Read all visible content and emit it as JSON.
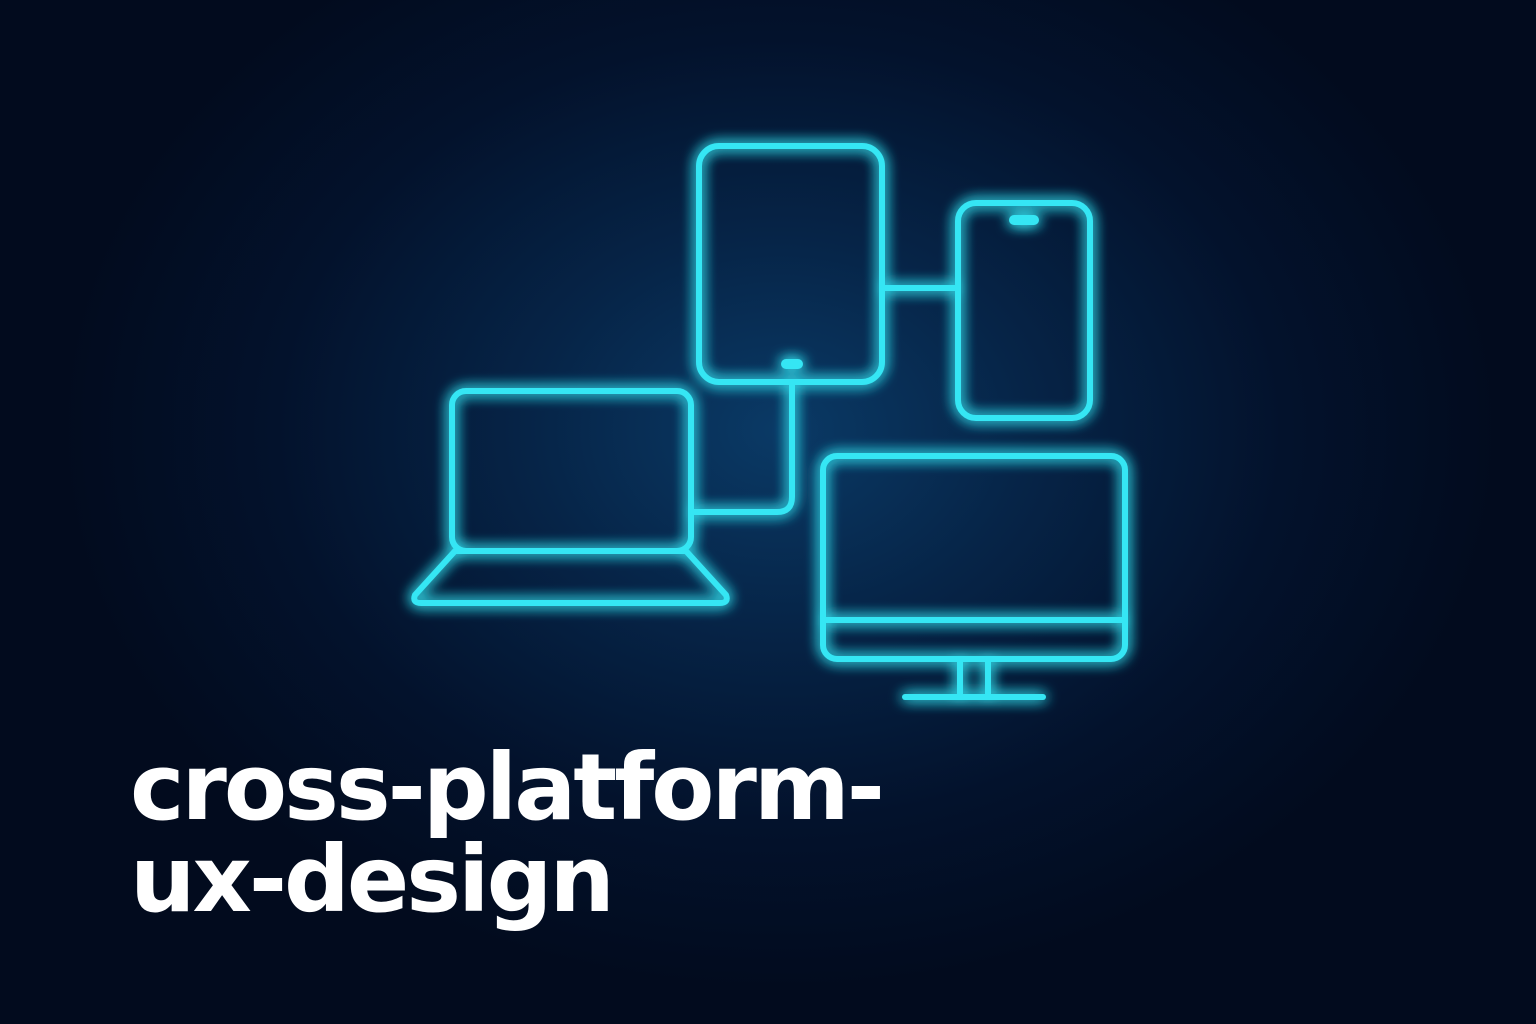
{
  "title": {
    "line1": "cross-platform-",
    "line2": "ux-design"
  },
  "colors": {
    "background": "#020b1e",
    "glow": "#0a3a66",
    "neon": "#34e6f4",
    "text": "#ffffff"
  },
  "icons": [
    "tablet-icon",
    "smartphone-icon",
    "laptop-icon",
    "desktop-monitor-icon",
    "connector-lines"
  ]
}
